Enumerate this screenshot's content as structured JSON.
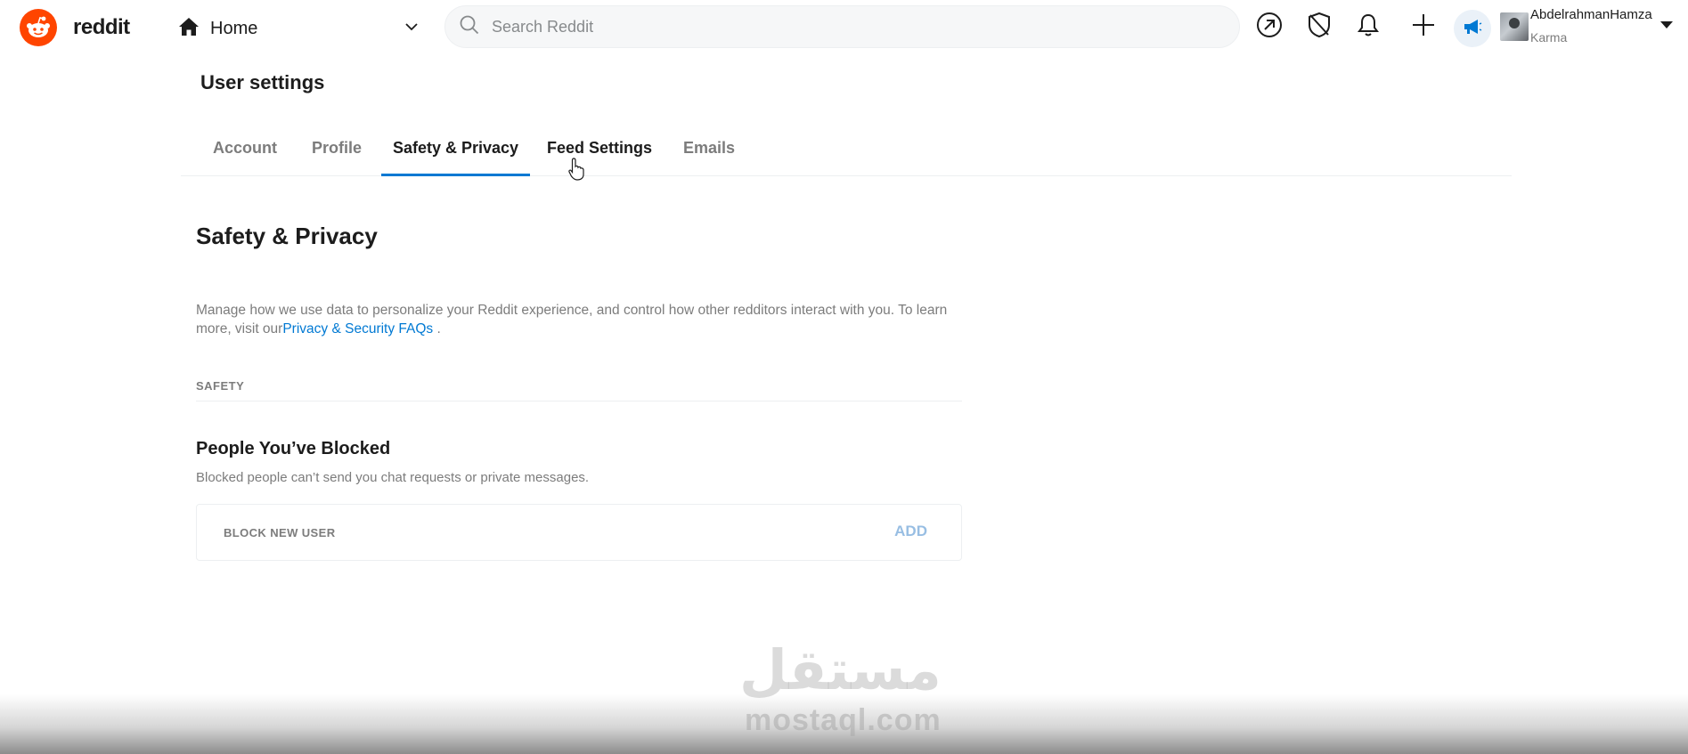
{
  "header": {
    "wordmark": "reddit",
    "feed_selector": "Home",
    "search_placeholder": "Search Reddit",
    "user": {
      "name": "AbdelrahmanHamza",
      "karma_label": "Karma"
    }
  },
  "settings": {
    "title": "User settings",
    "tabs": [
      {
        "label": "Account"
      },
      {
        "label": "Profile"
      },
      {
        "label": "Safety & Privacy",
        "active": true
      },
      {
        "label": "Feed Settings"
      },
      {
        "label": "Emails"
      }
    ],
    "section": {
      "title": "Safety & Privacy",
      "description": "Manage how we use data to personalize your Reddit experience, and control how other redditors interact with you. To learn more, visit our",
      "link_text": "Privacy & Security FAQs",
      "description_end": " .",
      "subhead": "SAFETY",
      "blocked": {
        "title": "People You’ve Blocked",
        "description": "Blocked people can’t send you chat requests or private messages.",
        "input_placeholder": "BLOCK NEW USER",
        "add_label": "ADD"
      }
    }
  },
  "watermark": {
    "arabic": "مستقل",
    "latin": "mostaql.com"
  },
  "colors": {
    "brand": "#ff4500",
    "accent": "#0079d3",
    "add_disabled": "#98bee3"
  },
  "icons": [
    "reddit-logo-icon",
    "home-icon",
    "chevron-down-icon",
    "search-icon",
    "popular-icon",
    "moderation-shield-icon",
    "notification-bell-icon",
    "create-post-icon",
    "advertise-megaphone-icon",
    "avatar",
    "pointer-cursor-icon"
  ]
}
